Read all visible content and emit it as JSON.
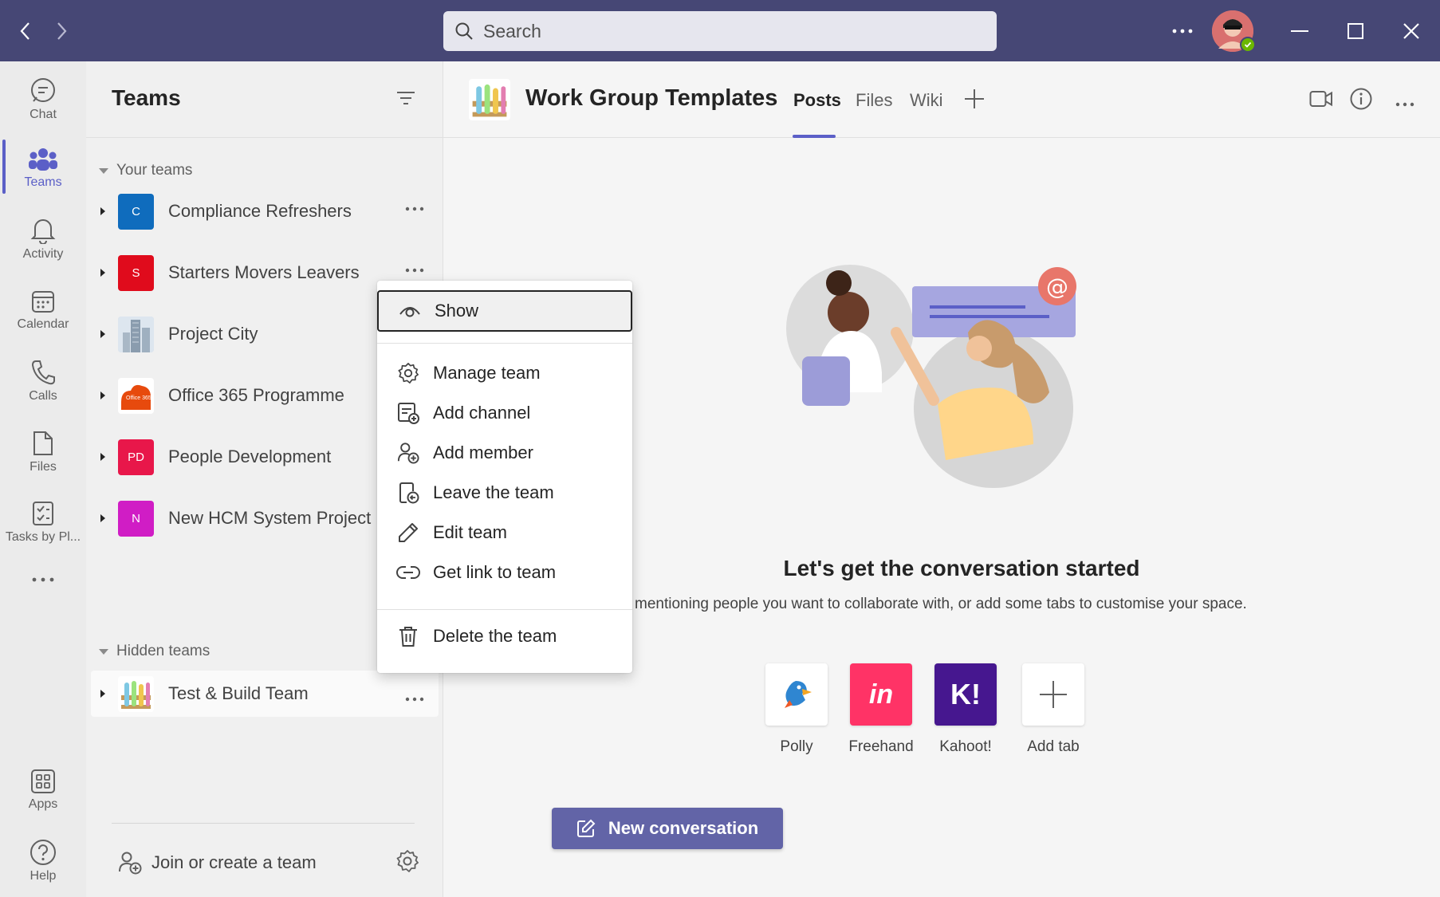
{
  "titlebar": {
    "search_placeholder": "Search",
    "colors": {
      "background": "#464775",
      "presence": "#6bb700"
    }
  },
  "rail": {
    "items": [
      {
        "label": "Chat",
        "icon": "chat-icon"
      },
      {
        "label": "Teams",
        "icon": "teams-icon",
        "active": true
      },
      {
        "label": "Activity",
        "icon": "bell-icon"
      },
      {
        "label": "Calendar",
        "icon": "calendar-icon"
      },
      {
        "label": "Calls",
        "icon": "phone-icon"
      },
      {
        "label": "Files",
        "icon": "file-icon"
      },
      {
        "label": "Tasks by Pl...",
        "icon": "tasks-icon"
      }
    ],
    "bottom": [
      {
        "label": "Apps",
        "icon": "apps-icon"
      },
      {
        "label": "Help",
        "icon": "help-icon"
      }
    ]
  },
  "teams_panel": {
    "title": "Teams",
    "your_teams_label": "Your teams",
    "hidden_teams_label": "Hidden teams",
    "teams": [
      {
        "name": "Compliance Refreshers",
        "initials": "C",
        "color": "#0f6cbd"
      },
      {
        "name": "Starters Movers Leavers",
        "initials": "S",
        "color": "#e00b1c"
      },
      {
        "name": "Project City",
        "initials": "",
        "color": "#8aa0b8"
      },
      {
        "name": "Office 365 Programme",
        "initials": "Office 365",
        "color": "#e74a0d"
      },
      {
        "name": "People Development",
        "initials": "PD",
        "color": "#e8174a"
      },
      {
        "name": "New HCM System Project",
        "initials": "N",
        "color": "#d01dc5"
      }
    ],
    "hidden_teams": [
      {
        "name": "Test & Build Team"
      }
    ],
    "join_label": "Join or create a team"
  },
  "main": {
    "channel_title": "Work Group Templates",
    "tabs": [
      {
        "label": "Posts",
        "active": true
      },
      {
        "label": "Files"
      },
      {
        "label": "Wiki"
      }
    ],
    "empty_title": "Let's get the conversation started",
    "empty_subtitle": "mentioning people you want to collaborate with, or add some tabs to customise your space.",
    "apps": [
      {
        "label": "Polly",
        "icon": "polly-icon",
        "color": "#ffffff"
      },
      {
        "label": "Freehand",
        "icon": "invision-icon",
        "color": "#ff3366",
        "glyph": "in"
      },
      {
        "label": "Kahoot!",
        "icon": "kahoot-icon",
        "color": "#46178f",
        "glyph": "K!"
      },
      {
        "label": "Add tab",
        "icon": "plus-icon",
        "color": "#ffffff"
      }
    ],
    "new_conversation_label": "New conversation",
    "accent": "#6264a7"
  },
  "context_menu": {
    "items": [
      {
        "label": "Show",
        "icon": "eye-icon",
        "focused": true
      },
      {
        "label": "Manage team",
        "icon": "gear-icon"
      },
      {
        "label": "Add channel",
        "icon": "add-channel-icon"
      },
      {
        "label": "Add member",
        "icon": "add-member-icon"
      },
      {
        "label": "Leave the team",
        "icon": "leave-icon"
      },
      {
        "label": "Edit team",
        "icon": "pencil-icon"
      },
      {
        "label": "Get link to team",
        "icon": "link-icon"
      },
      {
        "label": "Delete the team",
        "icon": "trash-icon"
      }
    ]
  }
}
